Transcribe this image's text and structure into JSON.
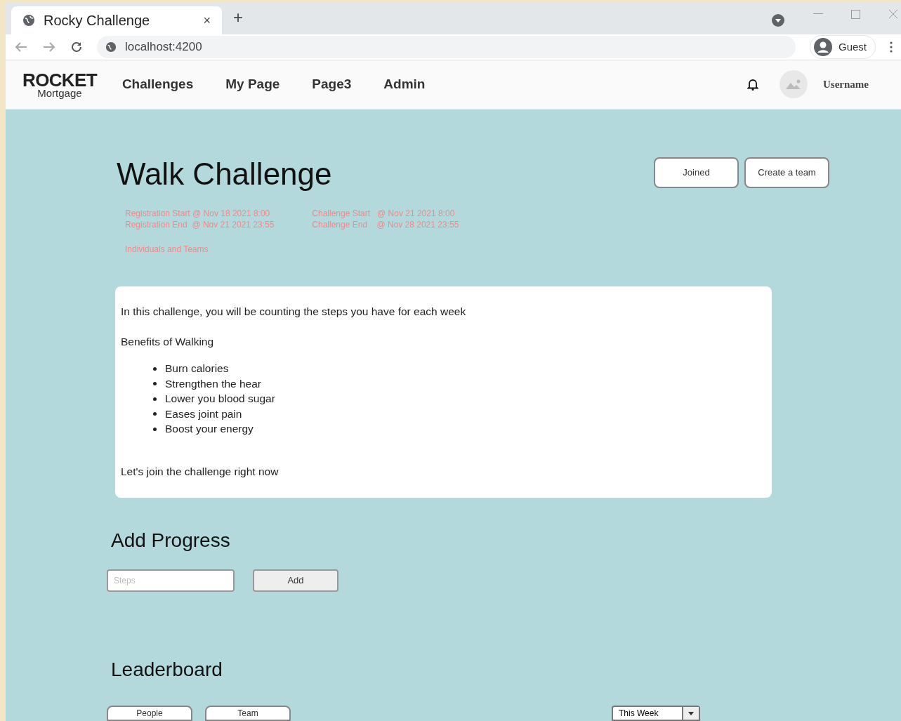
{
  "browser": {
    "tab_title": "Rocky Challenge",
    "tab_close": "×",
    "new_tab": "+",
    "url": "localhost:4200",
    "profile": "Guest"
  },
  "nav": {
    "logo_top": "ROCKET",
    "logo_bottom": "Mortgage",
    "links": [
      {
        "label": "Challenges",
        "selected": false
      },
      {
        "label": "My Page",
        "selected": false
      },
      {
        "label": "Page3",
        "selected": false
      },
      {
        "label": "Admin",
        "selected": false
      }
    ],
    "username": "Username"
  },
  "challenge": {
    "title": "Walk Challenge",
    "buttons": [
      "Joined",
      "Create a team"
    ],
    "dates": [
      [
        "Registration Start @ Nov 18 2021 8:00",
        "Registration End  @ Nov 21 2021 23:55"
      ],
      [
        "Challenge Start   @ Nov 21 2021 8:00",
        "Challenge End    @ Nov 28 2021 23:55"
      ]
    ],
    "mode": "Individuals and Teams",
    "description": {
      "intro": "In this challenge, you will be counting the steps you have for each week",
      "heading": "Benefits of Walking",
      "bullets": [
        "Burn calories",
        "Strengthen the hear",
        "Lower you blood sugar",
        "Eases joint pain",
        "Boost your energy"
      ],
      "closing": "Let's join the challenge right now"
    }
  },
  "add_progress": {
    "title": "Add Progress",
    "placeholder": "Steps",
    "button": "Add"
  },
  "leaderboard": {
    "title": "Leaderboard",
    "tabs": [
      {
        "label": "People",
        "selected": false
      },
      {
        "label": "Team",
        "selected": false
      }
    ],
    "period": "This Week"
  }
}
